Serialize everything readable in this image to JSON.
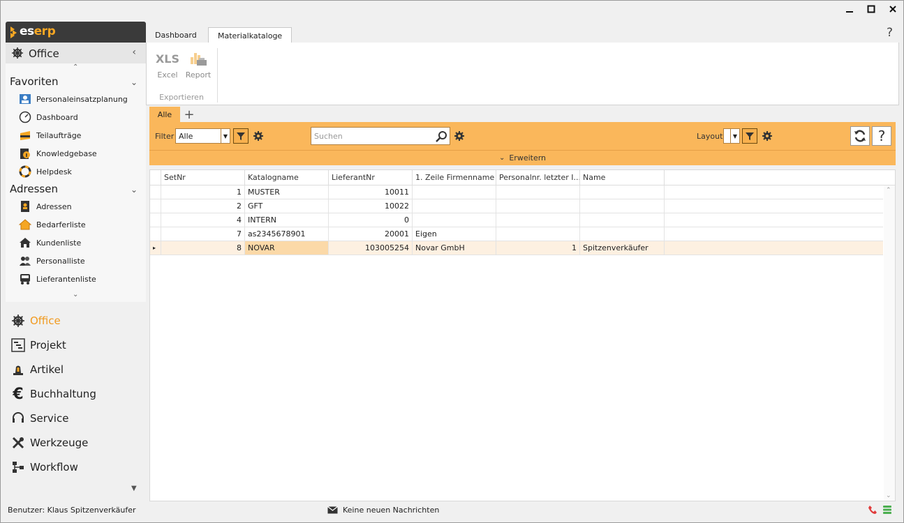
{
  "window": {
    "minimize": "▁",
    "maximize": "□",
    "close": "✕"
  },
  "logo": {
    "prefix": "es",
    "suffix": "erp"
  },
  "sidebar": {
    "module_header": "Office",
    "groups": [
      {
        "label": "Favoriten",
        "items": [
          "Personaleinsatzplanung",
          "Dashboard",
          "Teilaufträge",
          "Knowledgebase",
          "Helpdesk"
        ]
      },
      {
        "label": "Adressen",
        "items": [
          "Adressen",
          "Bedarferliste",
          "Kundenliste",
          "Personalliste",
          "Lieferantenliste"
        ]
      }
    ],
    "modules": [
      "Office",
      "Projekt",
      "Artikel",
      "Buchhaltung",
      "Service",
      "Werkzeuge",
      "Workflow"
    ]
  },
  "tabs": [
    "Dashboard",
    "Materialkataloge"
  ],
  "help": "?",
  "ribbon": {
    "excel_icon": "XLS",
    "excel_label": "Excel",
    "report_label": "Report",
    "group_label": "Exportieren"
  },
  "view_tabs": {
    "active": "Alle",
    "add": "+"
  },
  "toolbar": {
    "filter_label": "Filter",
    "filter_value": "Alle",
    "search_placeholder": "Suchen",
    "layout_label": "Layout",
    "layout_value": "",
    "expand_label": "Erweitern",
    "help": "?"
  },
  "colors": {
    "accent": "#fab75b",
    "module_active": "#f19a1f",
    "selected_row": "#fdf0e1"
  },
  "grid": {
    "columns": [
      "SetNr",
      "Katalogname",
      "LieferantNr",
      "1. Zeile Firmenname",
      "Personalnr. letzter I...",
      "Name"
    ],
    "rows": [
      [
        "1",
        "MUSTER",
        "10011",
        "",
        "",
        ""
      ],
      [
        "2",
        "GFT",
        "10022",
        "",
        "",
        ""
      ],
      [
        "4",
        "INTERN",
        "0",
        "",
        "",
        ""
      ],
      [
        "7",
        "as2345678901",
        "20001",
        "Eigen",
        "",
        ""
      ],
      [
        "8",
        "NOVAR",
        "103005254",
        "Novar GmbH",
        "1",
        "Spitzenverkäufer"
      ]
    ],
    "selected_row_indicator": "▸"
  },
  "status": {
    "user": "Benutzer: Klaus Spitzenverkäufer",
    "messages": "Keine neuen Nachrichten"
  }
}
